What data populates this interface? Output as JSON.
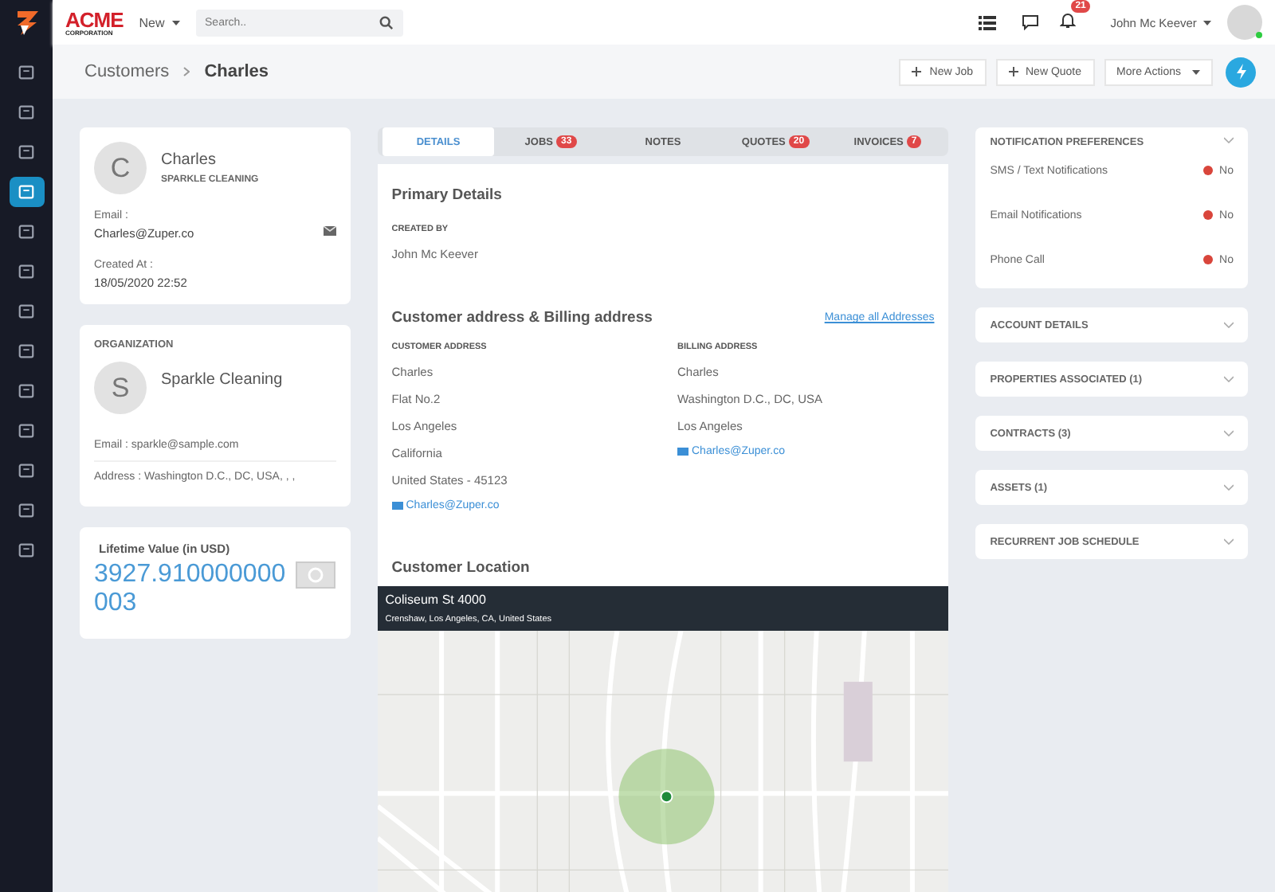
{
  "topbar": {
    "logo": {
      "name": "ACME",
      "sub": "CORPORATION"
    },
    "new_menu": "New",
    "search": {
      "placeholder": "Search.."
    },
    "notification_count": "21",
    "user": "John Mc Keever"
  },
  "sidebar": {
    "items": [
      {
        "selected": false
      },
      {
        "selected": false
      },
      {
        "selected": false
      },
      {
        "selected": true
      },
      {
        "selected": false
      },
      {
        "selected": false
      },
      {
        "selected": false
      },
      {
        "selected": false
      },
      {
        "selected": false
      },
      {
        "selected": false
      },
      {
        "selected": false
      },
      {
        "selected": false
      },
      {
        "selected": false
      }
    ]
  },
  "header": {
    "breadcrumb": [
      "Customers",
      "Charles"
    ],
    "actions": [
      "New Job",
      "New Quote"
    ],
    "more_actions": "More Actions"
  },
  "customer": {
    "initial": "C",
    "name": "Charles",
    "company": "SPARKLE CLEANING",
    "email_label": "Email :",
    "email": "Charles@Zuper.co",
    "created_label": "Created At :",
    "created": "18/05/2020 22:52"
  },
  "organization": {
    "title": "ORGANIZATION",
    "initial": "S",
    "name": "Sparkle Cleaning",
    "email": "Email : sparkle@sample.com",
    "address": "Address : Washington D.C., DC, USA, , ,"
  },
  "lifetime": {
    "label": "Lifetime Value (in USD)",
    "value": "3927.910000000003"
  },
  "tabs": [
    {
      "label": "DETAILS",
      "selected": true
    },
    {
      "label": "JOBS",
      "count": "33",
      "selected": false
    },
    {
      "label": "NOTES",
      "selected": false
    },
    {
      "label": "QUOTES",
      "count": "20",
      "selected": false
    },
    {
      "label": "INVOICES",
      "count": "7",
      "selected": false
    }
  ],
  "primary": {
    "title": "Primary Details",
    "created_by_label": "CREATED BY",
    "created_by": "John Mc Keever"
  },
  "addresses": {
    "title": "Customer address & Billing address",
    "manage_link": "Manage all Addresses",
    "columns": [
      {
        "heading": "CUSTOMER ADDRESS",
        "lines": [
          "Charles",
          "Flat No.2",
          "Los Angeles",
          "California",
          "United States - 45123"
        ],
        "email": "Charles@Zuper.co"
      },
      {
        "heading": "BILLING ADDRESS",
        "lines": [
          "Charles",
          "Washington D.C., DC, USA",
          "Los Angeles"
        ],
        "email": "Charles@Zuper.co"
      }
    ]
  },
  "location": {
    "title": "Customer Location",
    "place": "Coliseum St 4000",
    "address": "Crenshaw, Los Angeles, CA, United States"
  },
  "notification_preferences": {
    "title": "NOTIFICATION PREFERENCES",
    "items": [
      {
        "label": "SMS / Text Notifications",
        "value": "No",
        "color": "#d9453b"
      },
      {
        "label": "Email Notifications",
        "value": "No",
        "color": "#d9453b"
      },
      {
        "label": "Phone Call",
        "value": "No",
        "color": "#d9453b"
      }
    ]
  },
  "sections": [
    {
      "title": "ACCOUNT DETAILS",
      "expanded": false
    },
    {
      "title": "PROPERTIES ASSOCIATED (1)",
      "expanded": false
    },
    {
      "title": "CONTRACTS (3)",
      "expanded": false
    },
    {
      "title": "ASSETS (1)",
      "expanded": false
    },
    {
      "title": "RECURRENT JOB SCHEDULE",
      "expanded": false
    }
  ]
}
